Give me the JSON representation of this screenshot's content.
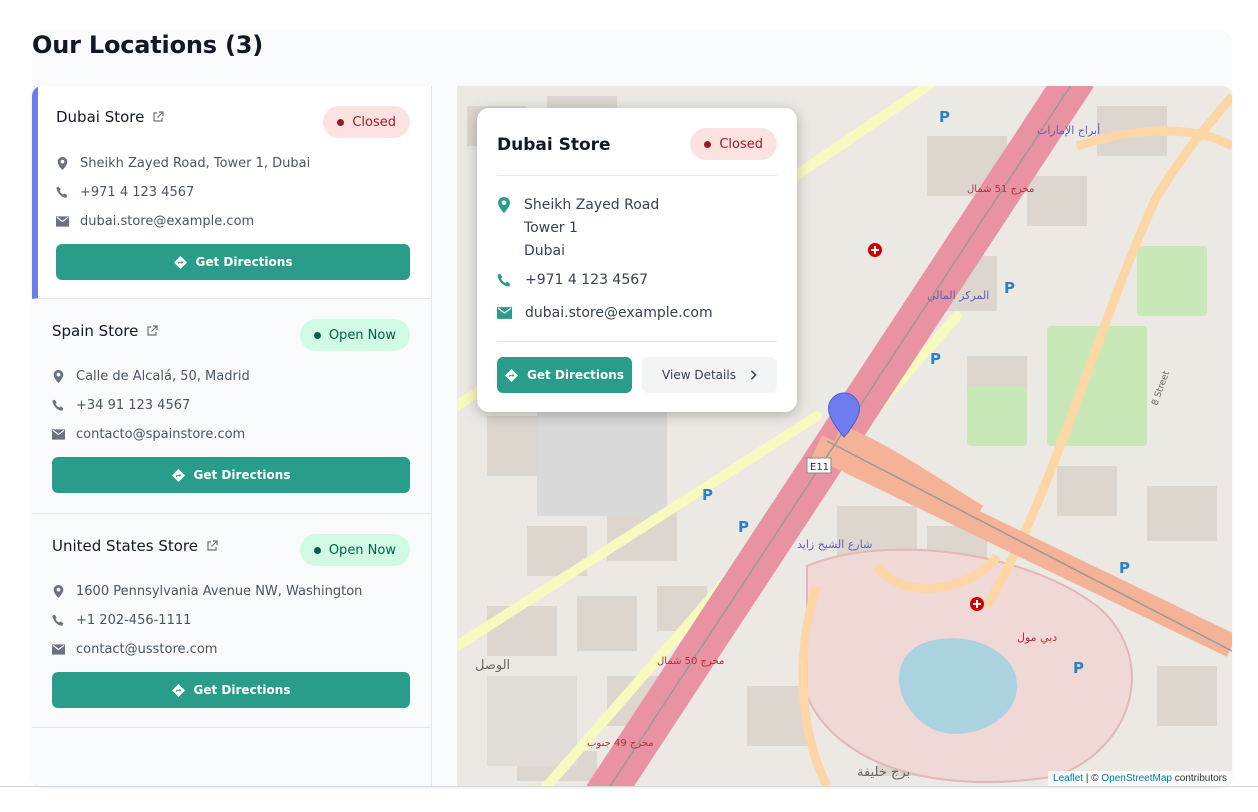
{
  "page": {
    "title": "Our Locations (3)"
  },
  "stores": [
    {
      "name": "Dubai Store",
      "status": "Closed",
      "address": "Sheikh Zayed Road, Tower 1, Dubai",
      "phone": "+971 4 123 4567",
      "email": "dubai.store@example.com",
      "directions_label": "Get Directions"
    },
    {
      "name": "Spain Store",
      "status": "Open Now",
      "address": "Calle de Alcalá, 50, Madrid",
      "phone": "+34 91 123 4567",
      "email": "contacto@spainstore.com",
      "directions_label": "Get Directions"
    },
    {
      "name": "United States Store",
      "status": "Open Now",
      "address": "1600 Pennsylvania Avenue NW, Washington",
      "phone": "+1 202-456-1111",
      "email": "contact@usstore.com",
      "directions_label": "Get Directions"
    }
  ],
  "popup": {
    "title": "Dubai Store",
    "status": "Closed",
    "address_line1": "Sheikh Zayed Road",
    "address_line2": "Tower 1",
    "address_line3": "Dubai",
    "phone": "+971 4 123 4567",
    "email": "dubai.store@example.com",
    "directions_label": "Get Directions",
    "details_label": "View Details"
  },
  "map": {
    "labels": {
      "road_e11": "E11",
      "burj_khalifa": "برج خليفة",
      "dubai_mall": "دبي مول",
      "emirates_towers": "أبراج الإمارات",
      "financial_center": "المركز المالي",
      "al_wasl": "الوصل",
      "street_8": "8 Street",
      "exit_51": "مخرج 51 شمال",
      "exit_50": "مخرج 50 شمال",
      "exit_49": "مخرج 49 جنوب",
      "sheikh_zayed_rd": "شارع الشيخ زايد",
      "parking": "P"
    },
    "attribution": {
      "leaflet": "Leaflet",
      "separator": " | © ",
      "osm": "OpenStreetMap",
      "contributors": " contributors"
    }
  },
  "colors": {
    "accent": "#2a9d8a",
    "active_border": "#6d7df0",
    "closed_bg": "#fde2e2",
    "closed_text": "#9b1c1c",
    "open_bg": "#d1fae5",
    "open_text": "#065f46",
    "marker": "#6d7df0"
  }
}
